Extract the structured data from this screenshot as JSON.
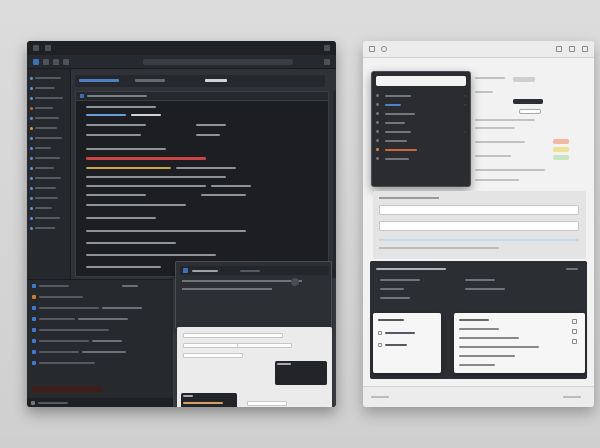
{
  "left_window": {
    "title": "",
    "address_bar": "",
    "sidebar_items": 18,
    "dialog_title": "",
    "dialog_button": "",
    "footer_label": "",
    "status_label": ""
  },
  "right_window": {
    "title": "",
    "dropdown": {
      "search_value": "",
      "items": [
        {
          "label": "",
          "state": "normal"
        },
        {
          "label": "",
          "state": "normal"
        },
        {
          "label": "",
          "state": "normal"
        },
        {
          "label": "",
          "state": "normal"
        },
        {
          "label": "",
          "state": "normal"
        },
        {
          "label": "",
          "state": "normal"
        },
        {
          "label": "",
          "state": "warning"
        },
        {
          "label": "",
          "state": "normal"
        }
      ]
    },
    "dark_panel_title": "",
    "left_card_items": [
      "",
      "",
      ""
    ],
    "right_card_items": [
      "",
      "",
      "",
      "",
      "",
      ""
    ]
  },
  "colors": {
    "accent_blue": "#3d6fb8",
    "highlight_red": "#c94343",
    "warning_orange": "#e27c55",
    "dark_bg": "#2b2e33",
    "light_bg": "#f2f2f2"
  }
}
